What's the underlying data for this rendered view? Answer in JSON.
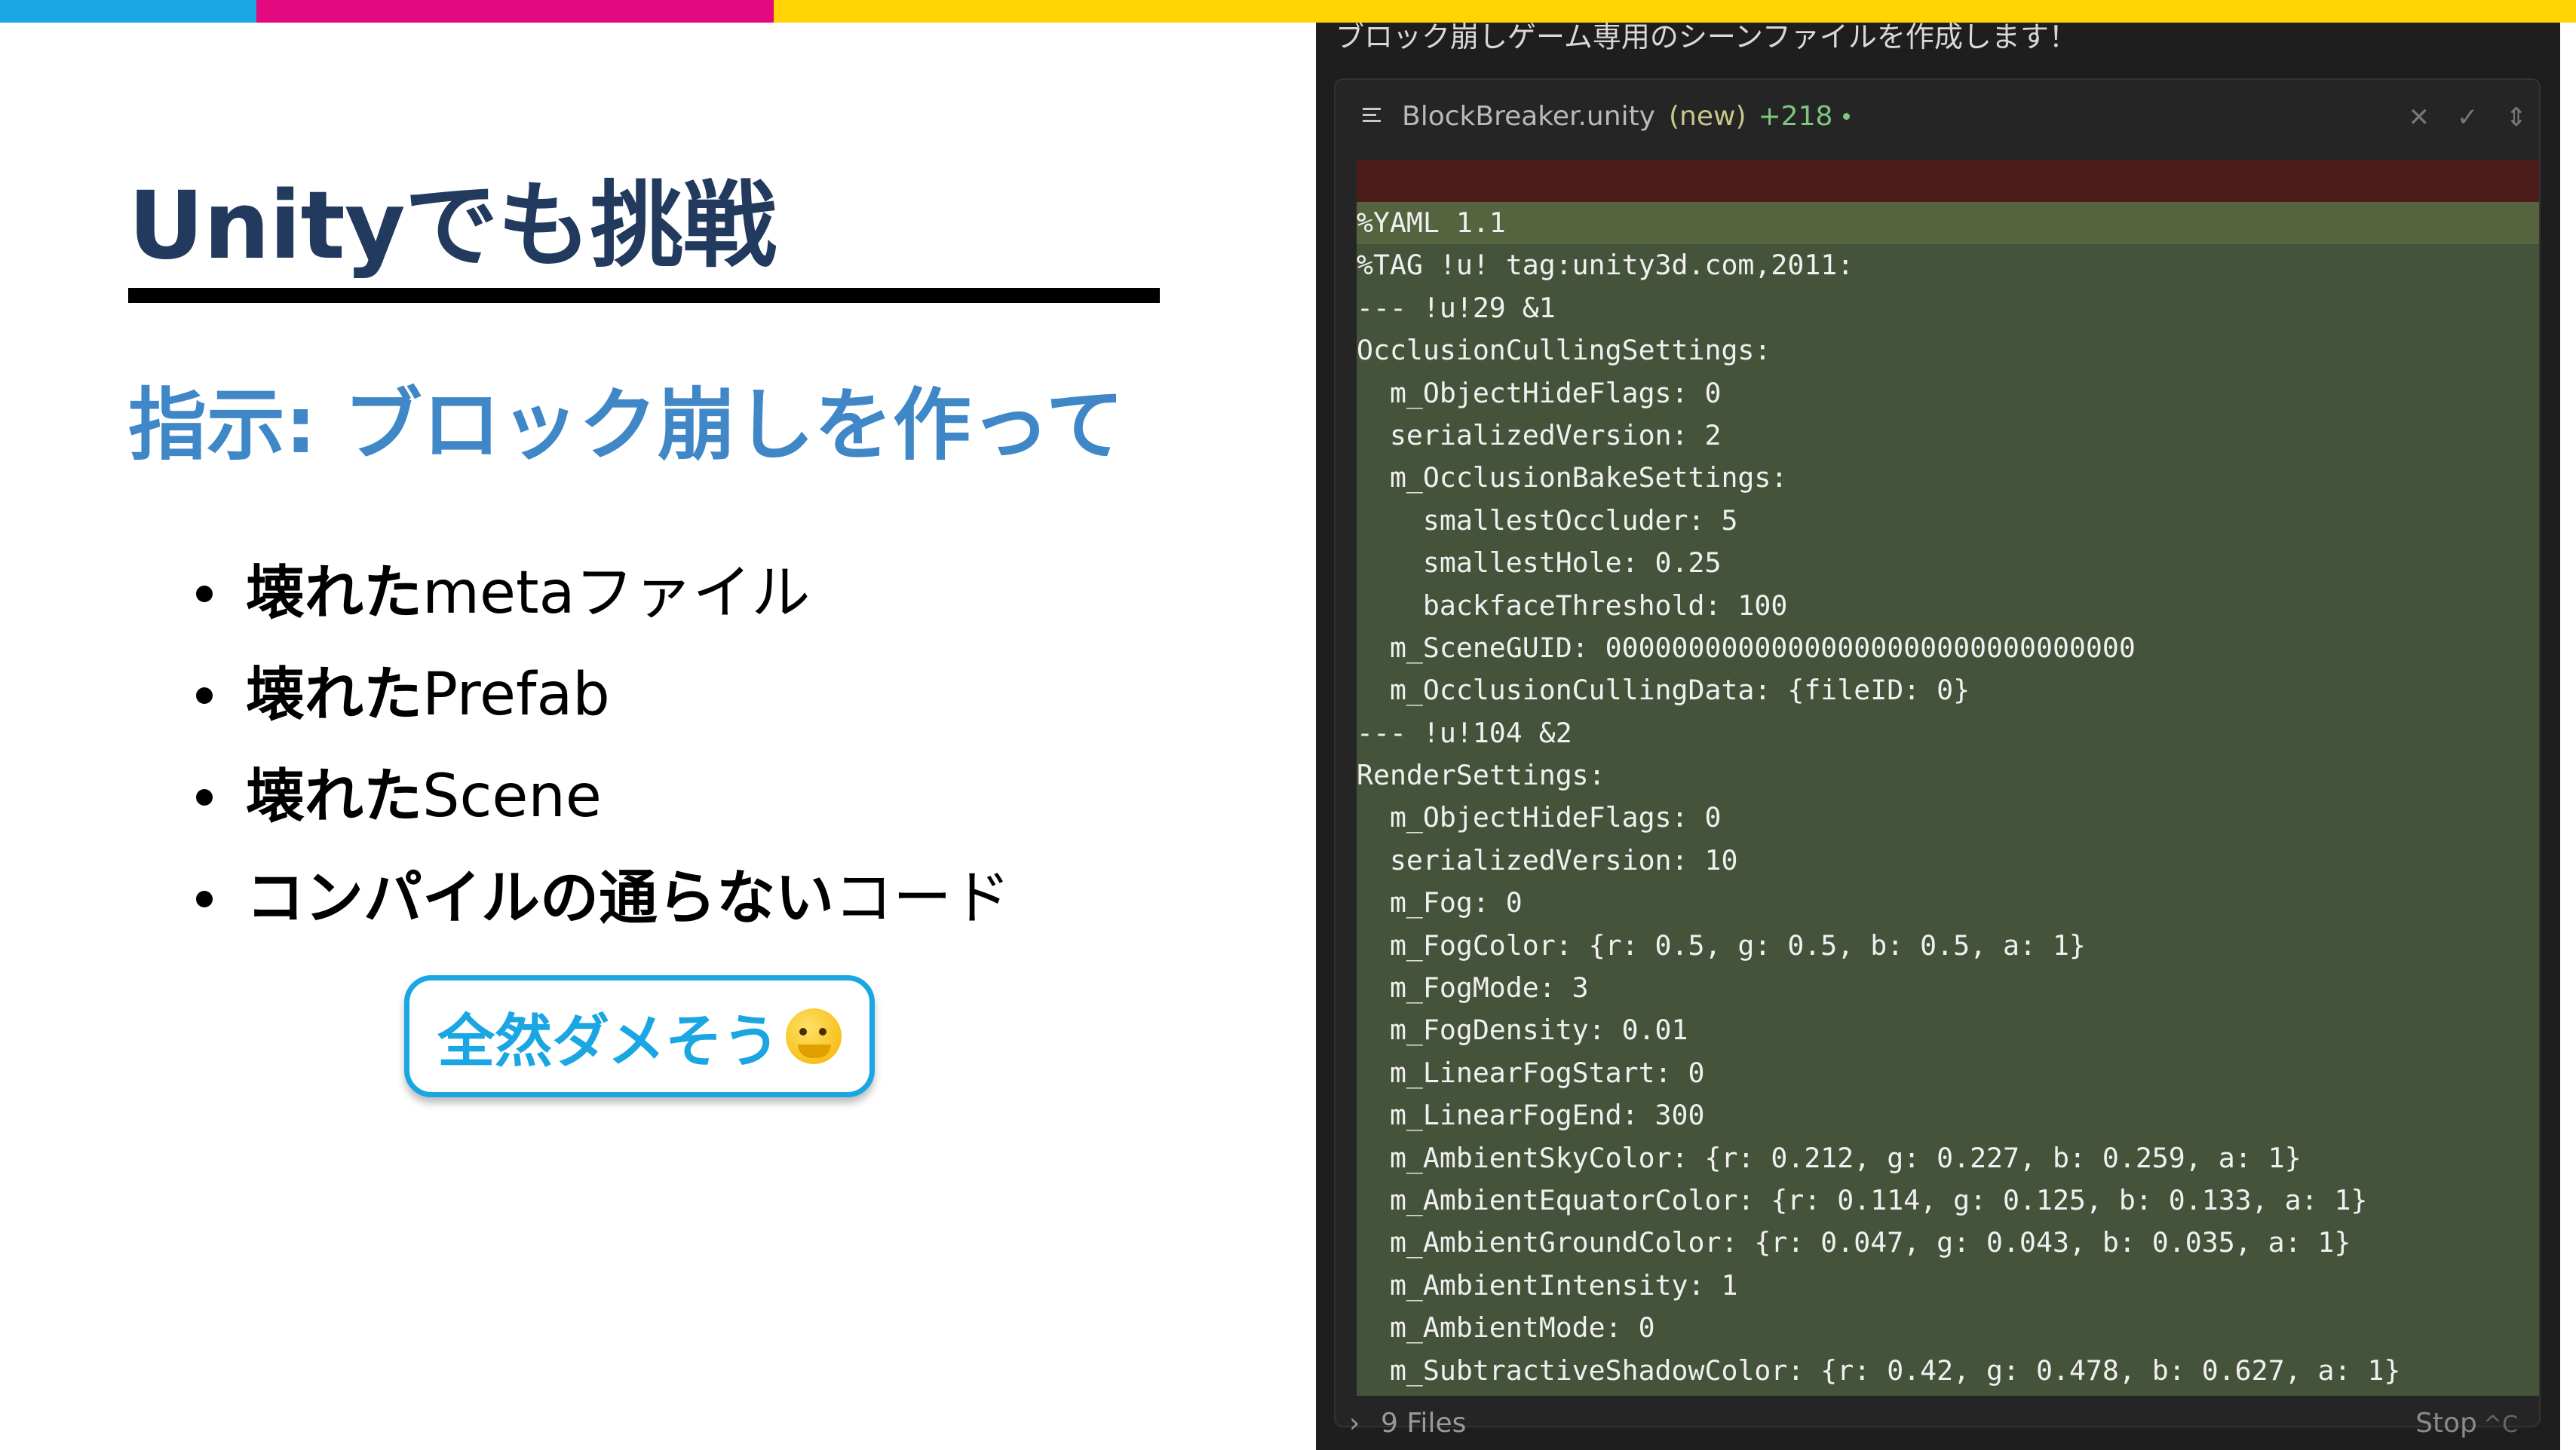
{
  "colors": {
    "bar_blue": "#1aa6e2",
    "bar_pink": "#e5097f",
    "bar_yellow": "#ffd400",
    "title": "#213a5e",
    "subtitle": "#3f87c7",
    "badge": "#1aa6e2",
    "code_added_bg": "#46533b",
    "code_removed_bg": "#4b1c1a"
  },
  "slide": {
    "title": "Unityでも挑戦",
    "subtitle": "指示: ブロック崩しを作って",
    "bullets": [
      {
        "strong": "壊れた",
        "rest": "metaファイル"
      },
      {
        "strong": "壊れた",
        "rest": "Prefab"
      },
      {
        "strong": "壊れた",
        "rest": "Scene"
      },
      {
        "strong": "コンパイルの通らない",
        "rest": "コード"
      }
    ],
    "badge_text": "全然ダメそう",
    "badge_icon": "melting-face-icon"
  },
  "editor": {
    "caption": "ブロック崩しゲーム専用のシーンファイルを作成します！",
    "file": {
      "icon": "list-lines-icon",
      "name": "BlockBreaker.unity",
      "status": "(new)",
      "added": "+218",
      "actions": [
        "close-icon",
        "check-icon",
        "expand-icon"
      ]
    },
    "code_lines": [
      "%YAML 1.1",
      "%TAG !u! tag:unity3d.com,2011:",
      "--- !u!29 &1",
      "OcclusionCullingSettings:",
      "  m_ObjectHideFlags: 0",
      "  serializedVersion: 2",
      "  m_OcclusionBakeSettings:",
      "    smallestOccluder: 5",
      "    smallestHole: 0.25",
      "    backfaceThreshold: 100",
      "  m_SceneGUID: 00000000000000000000000000000000",
      "  m_OcclusionCullingData: {fileID: 0}",
      "--- !u!104 &2",
      "RenderSettings:",
      "  m_ObjectHideFlags: 0",
      "  serializedVersion: 10",
      "  m_Fog: 0",
      "  m_FogColor: {r: 0.5, g: 0.5, b: 0.5, a: 1}",
      "  m_FogMode: 3",
      "  m_FogDensity: 0.01",
      "  m_LinearFogStart: 0",
      "  m_LinearFogEnd: 300",
      "  m_AmbientSkyColor: {r: 0.212, g: 0.227, b: 0.259, a: 1}",
      "  m_AmbientEquatorColor: {r: 0.114, g: 0.125, b: 0.133, a: 1}",
      "  m_AmbientGroundColor: {r: 0.047, g: 0.043, b: 0.035, a: 1}",
      "  m_AmbientIntensity: 1",
      "  m_AmbientMode: 0",
      "  m_SubtractiveShadowColor: {r: 0.42, g: 0.478, b: 0.627, a: 1}"
    ],
    "files_bar": {
      "label": "9 Files",
      "stop_label": "Stop",
      "stop_shortcut": "^C"
    }
  }
}
